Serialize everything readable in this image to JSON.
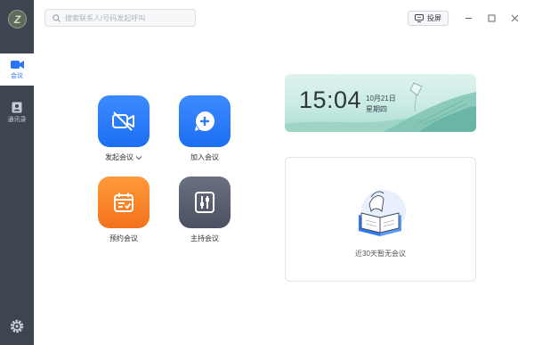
{
  "app": {
    "logo_letter": "Z"
  },
  "sidebar": {
    "items": [
      {
        "label": "会议",
        "icon": "video-camera-icon",
        "active": true
      },
      {
        "label": "通讯录",
        "icon": "contacts-icon",
        "active": false
      }
    ],
    "settings_icon": "gear-icon"
  },
  "search": {
    "placeholder": "搜索联系人/号码发起呼叫"
  },
  "toolbar": {
    "cast_label": "投屏"
  },
  "actions": [
    {
      "label": "发起会议",
      "icon": "video-off-icon",
      "color": "#2a7cf7",
      "has_dropdown": true
    },
    {
      "label": "加入会议",
      "icon": "plus-chat-icon",
      "color": "#2a7cf7"
    },
    {
      "label": "预约会议",
      "icon": "calendar-icon",
      "color": "#f5812a"
    },
    {
      "label": "主持会议",
      "icon": "sliders-icon",
      "color": "#565c6b"
    }
  ],
  "clock": {
    "time": "15:04",
    "date": "10月21日",
    "weekday": "星期四"
  },
  "recent": {
    "empty_text": "近30天暂无会议"
  },
  "colors": {
    "accent": "#2a74f5",
    "sidebar_bg": "#3f4451",
    "banner_bg": "#cfece5"
  }
}
